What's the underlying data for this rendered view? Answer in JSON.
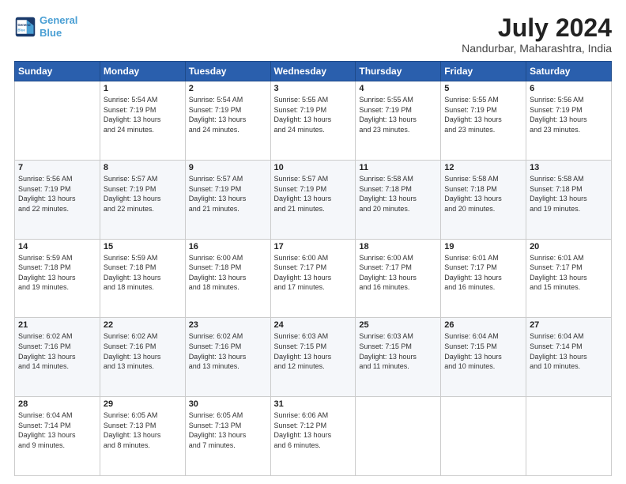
{
  "header": {
    "logo_line1": "General",
    "logo_line2": "Blue",
    "month": "July 2024",
    "location": "Nandurbar, Maharashtra, India"
  },
  "weekdays": [
    "Sunday",
    "Monday",
    "Tuesday",
    "Wednesday",
    "Thursday",
    "Friday",
    "Saturday"
  ],
  "weeks": [
    [
      {
        "day": "",
        "info": ""
      },
      {
        "day": "1",
        "info": "Sunrise: 5:54 AM\nSunset: 7:19 PM\nDaylight: 13 hours\nand 24 minutes."
      },
      {
        "day": "2",
        "info": "Sunrise: 5:54 AM\nSunset: 7:19 PM\nDaylight: 13 hours\nand 24 minutes."
      },
      {
        "day": "3",
        "info": "Sunrise: 5:55 AM\nSunset: 7:19 PM\nDaylight: 13 hours\nand 24 minutes."
      },
      {
        "day": "4",
        "info": "Sunrise: 5:55 AM\nSunset: 7:19 PM\nDaylight: 13 hours\nand 23 minutes."
      },
      {
        "day": "5",
        "info": "Sunrise: 5:55 AM\nSunset: 7:19 PM\nDaylight: 13 hours\nand 23 minutes."
      },
      {
        "day": "6",
        "info": "Sunrise: 5:56 AM\nSunset: 7:19 PM\nDaylight: 13 hours\nand 23 minutes."
      }
    ],
    [
      {
        "day": "7",
        "info": "Sunrise: 5:56 AM\nSunset: 7:19 PM\nDaylight: 13 hours\nand 22 minutes."
      },
      {
        "day": "8",
        "info": "Sunrise: 5:57 AM\nSunset: 7:19 PM\nDaylight: 13 hours\nand 22 minutes."
      },
      {
        "day": "9",
        "info": "Sunrise: 5:57 AM\nSunset: 7:19 PM\nDaylight: 13 hours\nand 21 minutes."
      },
      {
        "day": "10",
        "info": "Sunrise: 5:57 AM\nSunset: 7:19 PM\nDaylight: 13 hours\nand 21 minutes."
      },
      {
        "day": "11",
        "info": "Sunrise: 5:58 AM\nSunset: 7:18 PM\nDaylight: 13 hours\nand 20 minutes."
      },
      {
        "day": "12",
        "info": "Sunrise: 5:58 AM\nSunset: 7:18 PM\nDaylight: 13 hours\nand 20 minutes."
      },
      {
        "day": "13",
        "info": "Sunrise: 5:58 AM\nSunset: 7:18 PM\nDaylight: 13 hours\nand 19 minutes."
      }
    ],
    [
      {
        "day": "14",
        "info": "Sunrise: 5:59 AM\nSunset: 7:18 PM\nDaylight: 13 hours\nand 19 minutes."
      },
      {
        "day": "15",
        "info": "Sunrise: 5:59 AM\nSunset: 7:18 PM\nDaylight: 13 hours\nand 18 minutes."
      },
      {
        "day": "16",
        "info": "Sunrise: 6:00 AM\nSunset: 7:18 PM\nDaylight: 13 hours\nand 18 minutes."
      },
      {
        "day": "17",
        "info": "Sunrise: 6:00 AM\nSunset: 7:17 PM\nDaylight: 13 hours\nand 17 minutes."
      },
      {
        "day": "18",
        "info": "Sunrise: 6:00 AM\nSunset: 7:17 PM\nDaylight: 13 hours\nand 16 minutes."
      },
      {
        "day": "19",
        "info": "Sunrise: 6:01 AM\nSunset: 7:17 PM\nDaylight: 13 hours\nand 16 minutes."
      },
      {
        "day": "20",
        "info": "Sunrise: 6:01 AM\nSunset: 7:17 PM\nDaylight: 13 hours\nand 15 minutes."
      }
    ],
    [
      {
        "day": "21",
        "info": "Sunrise: 6:02 AM\nSunset: 7:16 PM\nDaylight: 13 hours\nand 14 minutes."
      },
      {
        "day": "22",
        "info": "Sunrise: 6:02 AM\nSunset: 7:16 PM\nDaylight: 13 hours\nand 13 minutes."
      },
      {
        "day": "23",
        "info": "Sunrise: 6:02 AM\nSunset: 7:16 PM\nDaylight: 13 hours\nand 13 minutes."
      },
      {
        "day": "24",
        "info": "Sunrise: 6:03 AM\nSunset: 7:15 PM\nDaylight: 13 hours\nand 12 minutes."
      },
      {
        "day": "25",
        "info": "Sunrise: 6:03 AM\nSunset: 7:15 PM\nDaylight: 13 hours\nand 11 minutes."
      },
      {
        "day": "26",
        "info": "Sunrise: 6:04 AM\nSunset: 7:15 PM\nDaylight: 13 hours\nand 10 minutes."
      },
      {
        "day": "27",
        "info": "Sunrise: 6:04 AM\nSunset: 7:14 PM\nDaylight: 13 hours\nand 10 minutes."
      }
    ],
    [
      {
        "day": "28",
        "info": "Sunrise: 6:04 AM\nSunset: 7:14 PM\nDaylight: 13 hours\nand 9 minutes."
      },
      {
        "day": "29",
        "info": "Sunrise: 6:05 AM\nSunset: 7:13 PM\nDaylight: 13 hours\nand 8 minutes."
      },
      {
        "day": "30",
        "info": "Sunrise: 6:05 AM\nSunset: 7:13 PM\nDaylight: 13 hours\nand 7 minutes."
      },
      {
        "day": "31",
        "info": "Sunrise: 6:06 AM\nSunset: 7:12 PM\nDaylight: 13 hours\nand 6 minutes."
      },
      {
        "day": "",
        "info": ""
      },
      {
        "day": "",
        "info": ""
      },
      {
        "day": "",
        "info": ""
      }
    ]
  ]
}
